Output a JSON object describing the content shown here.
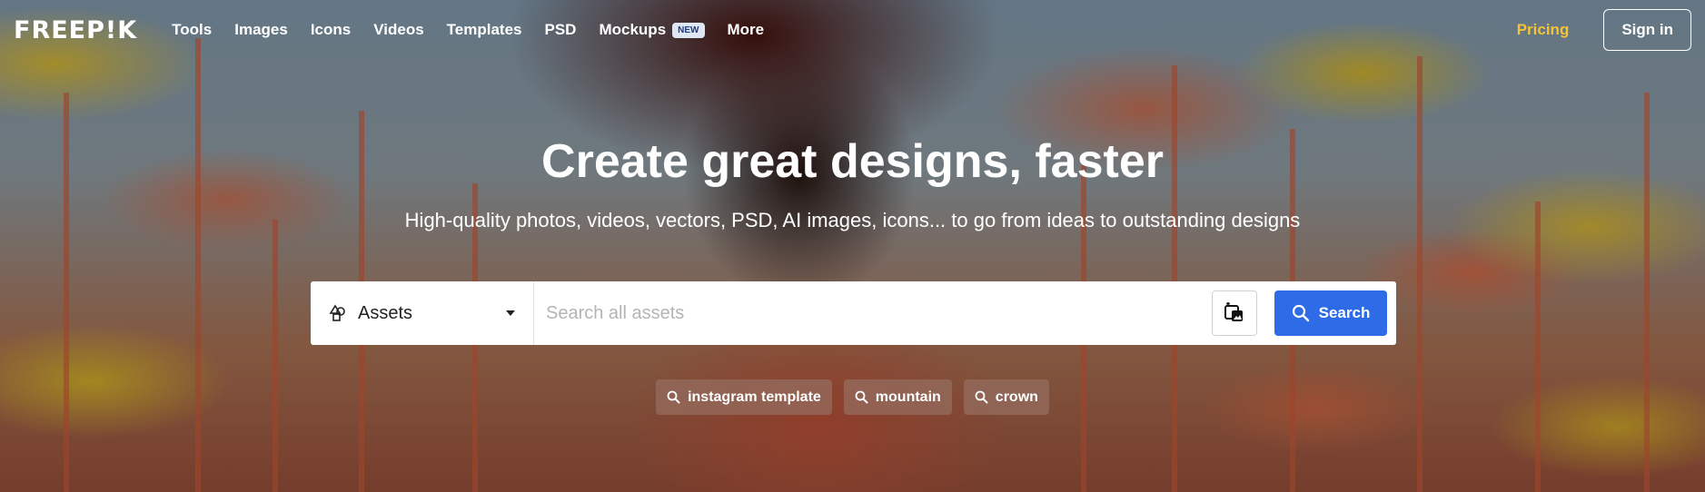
{
  "brand": {
    "logo": "FREEP!K"
  },
  "nav": {
    "items": [
      {
        "label": "Tools"
      },
      {
        "label": "Images"
      },
      {
        "label": "Icons"
      },
      {
        "label": "Videos"
      },
      {
        "label": "Templates"
      },
      {
        "label": "PSD"
      },
      {
        "label": "Mockups",
        "badge": "NEW"
      },
      {
        "label": "More"
      }
    ],
    "pricing_label": "Pricing",
    "signin_label": "Sign in"
  },
  "hero": {
    "title": "Create great designs, faster",
    "subtitle": "High-quality photos, videos, vectors, PSD, AI images, icons... to go from ideas to outstanding designs"
  },
  "search": {
    "category_selected": "Assets",
    "placeholder": "Search all assets",
    "value": "",
    "button_label": "Search"
  },
  "suggestions": [
    {
      "label": "instagram template"
    },
    {
      "label": "mountain"
    },
    {
      "label": "crown"
    }
  ],
  "colors": {
    "accent": "#2e6be6",
    "pricing": "#f5c238",
    "badge_bg": "#dfe6f4"
  }
}
